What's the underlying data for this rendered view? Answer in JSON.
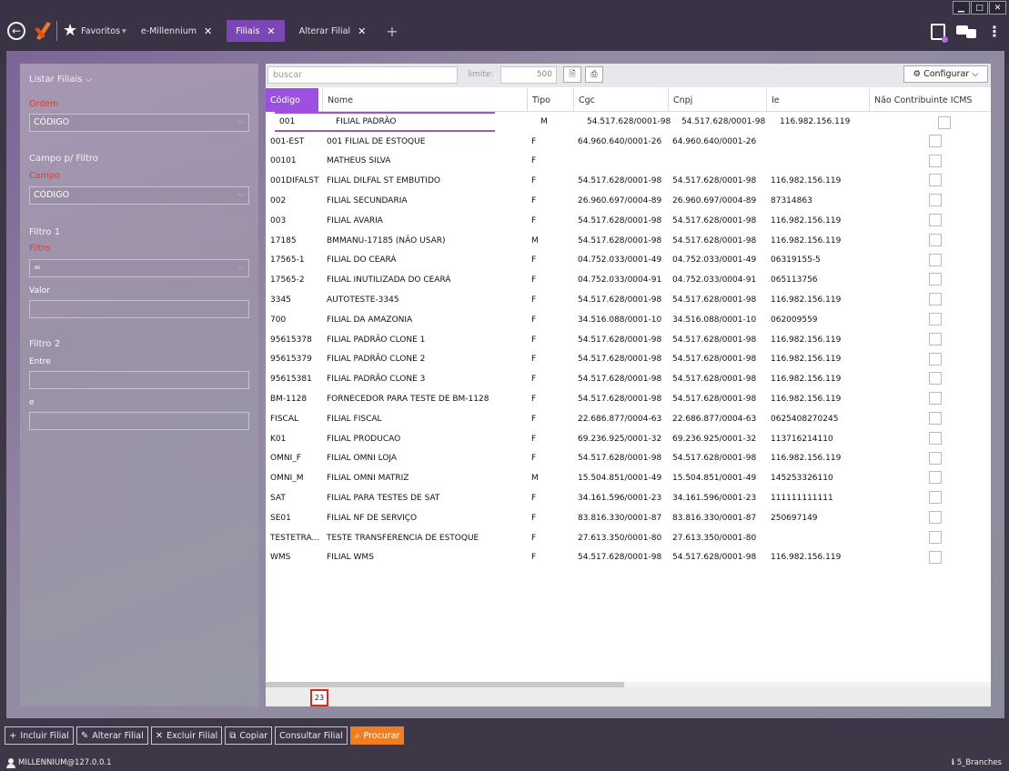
{
  "window": {
    "minimize": "▁",
    "maximize": "□",
    "close": "✕"
  },
  "topbar": {
    "favorites_label": "Favoritos",
    "favorites_caret": "▾",
    "tabs": [
      {
        "label": "e-Millennium",
        "close": "✕"
      },
      {
        "label": "Filiais",
        "close": "✕"
      },
      {
        "label": "Alterar Filial",
        "close": "✕"
      }
    ],
    "add_tab": "+"
  },
  "left_panel": {
    "title": "Listar Filiais",
    "ordem_label": "Ordem",
    "ordem_value": "CÓDIGO",
    "campo_filtro_title": "Campo p/ Filtro",
    "campo_label": "Campo",
    "campo_value": "CÓDIGO",
    "filtro1_title": "Filtro 1",
    "filtro_label": "Filtro",
    "filtro_value": "=",
    "valor_label": "Valor",
    "filtro2_title": "Filtro 2",
    "entre_label": "Entre",
    "e_label": "e"
  },
  "grid": {
    "search_placeholder": "buscar",
    "limit_label": "limite:",
    "limit_value": "500",
    "config_label": "Configurar",
    "columns": [
      "Código",
      "Nome",
      "Tipo",
      "Cgc",
      "Cnpj",
      "Ie",
      "Não Contribuinte ICMS"
    ],
    "rows": [
      {
        "codigo": "001",
        "nome": "FILIAL PADRÃO",
        "tipo": "M",
        "cgc": "54.517.628/0001-98",
        "cnpj": "54.517.628/0001-98",
        "ie": "116.982.156.119"
      },
      {
        "codigo": "001-EST",
        "nome": "001 FILIAL DE ESTOQUE",
        "tipo": "F",
        "cgc": "64.960.640/0001-26",
        "cnpj": "64.960.640/0001-26",
        "ie": ""
      },
      {
        "codigo": "00101",
        "nome": "MATHEUS SILVA",
        "tipo": "F",
        "cgc": "",
        "cnpj": "",
        "ie": ""
      },
      {
        "codigo": "001DIFALST",
        "nome": "FILIAL DILFAL ST EMBUTIDO",
        "tipo": "F",
        "cgc": "54.517.628/0001-98",
        "cnpj": "54.517.628/0001-98",
        "ie": "116.982.156.119"
      },
      {
        "codigo": "002",
        "nome": "FILIAL SECUNDARIA",
        "tipo": "F",
        "cgc": "26.960.697/0004-89",
        "cnpj": "26.960.697/0004-89",
        "ie": "87314863"
      },
      {
        "codigo": "003",
        "nome": "FILIAL AVARIA",
        "tipo": "F",
        "cgc": "54.517.628/0001-98",
        "cnpj": "54.517.628/0001-98",
        "ie": "116.982.156.119"
      },
      {
        "codigo": "17185",
        "nome": "BMMANU-17185 (NÃO USAR)",
        "tipo": "M",
        "cgc": "54.517.628/0001-98",
        "cnpj": "54.517.628/0001-98",
        "ie": "116.982.156.119"
      },
      {
        "codigo": "17565-1",
        "nome": "FILIAL DO CEARÁ",
        "tipo": "F",
        "cgc": "04.752.033/0001-49",
        "cnpj": "04.752.033/0001-49",
        "ie": "06319155-5"
      },
      {
        "codigo": "17565-2",
        "nome": "FILIAL INUTILIZADA DO CEARÁ",
        "tipo": "F",
        "cgc": "04.752.033/0004-91",
        "cnpj": "04.752.033/0004-91",
        "ie": "065113756"
      },
      {
        "codigo": "3345",
        "nome": "AUTOTESTE-3345",
        "tipo": "F",
        "cgc": "54.517.628/0001-98",
        "cnpj": "54.517.628/0001-98",
        "ie": "116.982.156.119"
      },
      {
        "codigo": "700",
        "nome": "FILIAL DA AMAZONIA",
        "tipo": "F",
        "cgc": "34.516.088/0001-10",
        "cnpj": "34.516.088/0001-10",
        "ie": "062009559"
      },
      {
        "codigo": "95615378",
        "nome": "FILIAL PADRÃO CLONE 1",
        "tipo": "F",
        "cgc": "54.517.628/0001-98",
        "cnpj": "54.517.628/0001-98",
        "ie": "116.982.156.119"
      },
      {
        "codigo": "95615379",
        "nome": "FILIAL PADRÃO CLONE 2",
        "tipo": "F",
        "cgc": "54.517.628/0001-98",
        "cnpj": "54.517.628/0001-98",
        "ie": "116.982.156.119"
      },
      {
        "codigo": "95615381",
        "nome": "FILIAL PADRÃO CLONE 3",
        "tipo": "F",
        "cgc": "54.517.628/0001-98",
        "cnpj": "54.517.628/0001-98",
        "ie": "116.982.156.119"
      },
      {
        "codigo": "BM-1128",
        "nome": "FORNECEDOR PARA TESTE DE BM-1128",
        "tipo": "F",
        "cgc": "54.517.628/0001-98",
        "cnpj": "54.517.628/0001-98",
        "ie": "116.982.156.119"
      },
      {
        "codigo": "FISCAL",
        "nome": "FILIAL FISCAL",
        "tipo": "F",
        "cgc": "22.686.877/0004-63",
        "cnpj": "22.686.877/0004-63",
        "ie": "0625408270245"
      },
      {
        "codigo": "K01",
        "nome": "FILIAL PRODUCAO",
        "tipo": "F",
        "cgc": "69.236.925/0001-32",
        "cnpj": "69.236.925/0001-32",
        "ie": "113716214110"
      },
      {
        "codigo": "OMNI_F",
        "nome": "FILIAL OMNI LOJA",
        "tipo": "F",
        "cgc": "54.517.628/0001-98",
        "cnpj": "54.517.628/0001-98",
        "ie": "116.982.156.119"
      },
      {
        "codigo": "OMNI_M",
        "nome": "FILIAL OMNI MATRIZ",
        "tipo": "M",
        "cgc": "15.504.851/0001-49",
        "cnpj": "15.504.851/0001-49",
        "ie": "145253326110"
      },
      {
        "codigo": "SAT",
        "nome": "FILIAL PARA TESTES DE SAT",
        "tipo": "F",
        "cgc": "34.161.596/0001-23",
        "cnpj": "34.161.596/0001-23",
        "ie": "111111111111"
      },
      {
        "codigo": "SE01",
        "nome": "FILIAL NF DE SERVIÇO",
        "tipo": "F",
        "cgc": "83.816.330/0001-87",
        "cnpj": "83.816.330/0001-87",
        "ie": "250697149"
      },
      {
        "codigo": "TESTETRA...",
        "nome": "TESTE TRANSFERENCIA DE ESTOQUE",
        "tipo": "F",
        "cgc": "27.613.350/0001-80",
        "cnpj": "27.613.350/0001-80",
        "ie": ""
      },
      {
        "codigo": "WMS",
        "nome": "FILIAL WMS",
        "tipo": "F",
        "cgc": "54.517.628/0001-98",
        "cnpj": "54.517.628/0001-98",
        "ie": "116.982.156.119"
      }
    ],
    "record_count": "23"
  },
  "actions": [
    {
      "icon": "+",
      "label": "Incluir Filial",
      "name": "incluir-filial-button"
    },
    {
      "icon": "✎",
      "label": "Alterar Filial",
      "name": "alterar-filial-button"
    },
    {
      "icon": "✕",
      "label": "Excluir Filial",
      "name": "excluir-filial-button"
    },
    {
      "icon": "⧉",
      "label": "Copiar",
      "name": "copiar-button"
    },
    {
      "icon": "",
      "label": "Consultar Filial",
      "name": "consultar-filial-button"
    },
    {
      "icon": "⌕",
      "label": "Procurar",
      "name": "procurar-button"
    }
  ],
  "status": {
    "user": "MILLENNIUM@127.0.0.1",
    "branch": "5_Branches"
  },
  "colors": {
    "accent": "#9c4fe0",
    "tab_active": "#7c47b5",
    "primary_action": "#ef7d22",
    "count_border": "#e1261b"
  }
}
